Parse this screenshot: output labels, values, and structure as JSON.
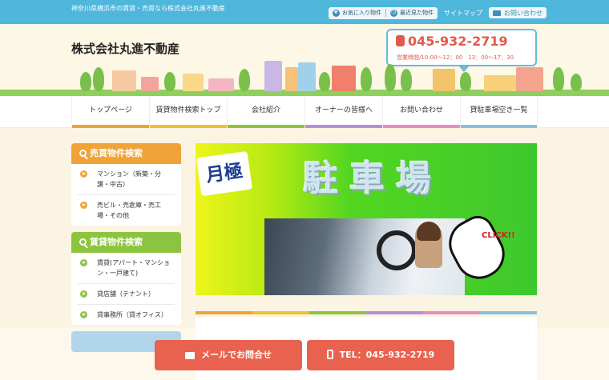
{
  "topbar": {
    "tagline": "神奈川県横浜市の賃貸・売買なら株式会社丸進不動産",
    "favorites": "お気に入り物件",
    "recent": "最近見た物件",
    "sitemap": "サイトマップ",
    "contact": "お問い合わせ"
  },
  "header": {
    "company": "株式会社丸進不動産",
    "phone": "045-932-2719",
    "hours": "営業時間/10:00～12：00　13：00～17：30"
  },
  "nav": [
    {
      "label": "トップページ",
      "color": "#f0a338"
    },
    {
      "label": "賃貸物件検索トップ",
      "color": "#f2c02c"
    },
    {
      "label": "会社紹介",
      "color": "#8cc43f"
    },
    {
      "label": "オーナーの皆様へ",
      "color": "#b48fd8"
    },
    {
      "label": "お問い合わせ",
      "color": "#e58ec4"
    },
    {
      "label": "貸駐車場空き一覧",
      "color": "#88bfe0"
    }
  ],
  "sidebar": {
    "sale": {
      "title": "売買物件検索",
      "items": [
        "マンション（新築・分譲・中古）",
        "売ビル・売倉庫・売工場・その他"
      ]
    },
    "rent": {
      "title": "賃貸物件検索",
      "items": [
        "賃貸(アパート・マンション・一戸建て)",
        "貸店舗（テナント）",
        "貸事務所（貸オフィス）"
      ]
    }
  },
  "banner": {
    "monthly": "月極",
    "parking": "駐車場",
    "click": "CLICK!!"
  },
  "cta": {
    "mail": "メールでお問合せ",
    "tel": "TEL：045-932-2719"
  }
}
